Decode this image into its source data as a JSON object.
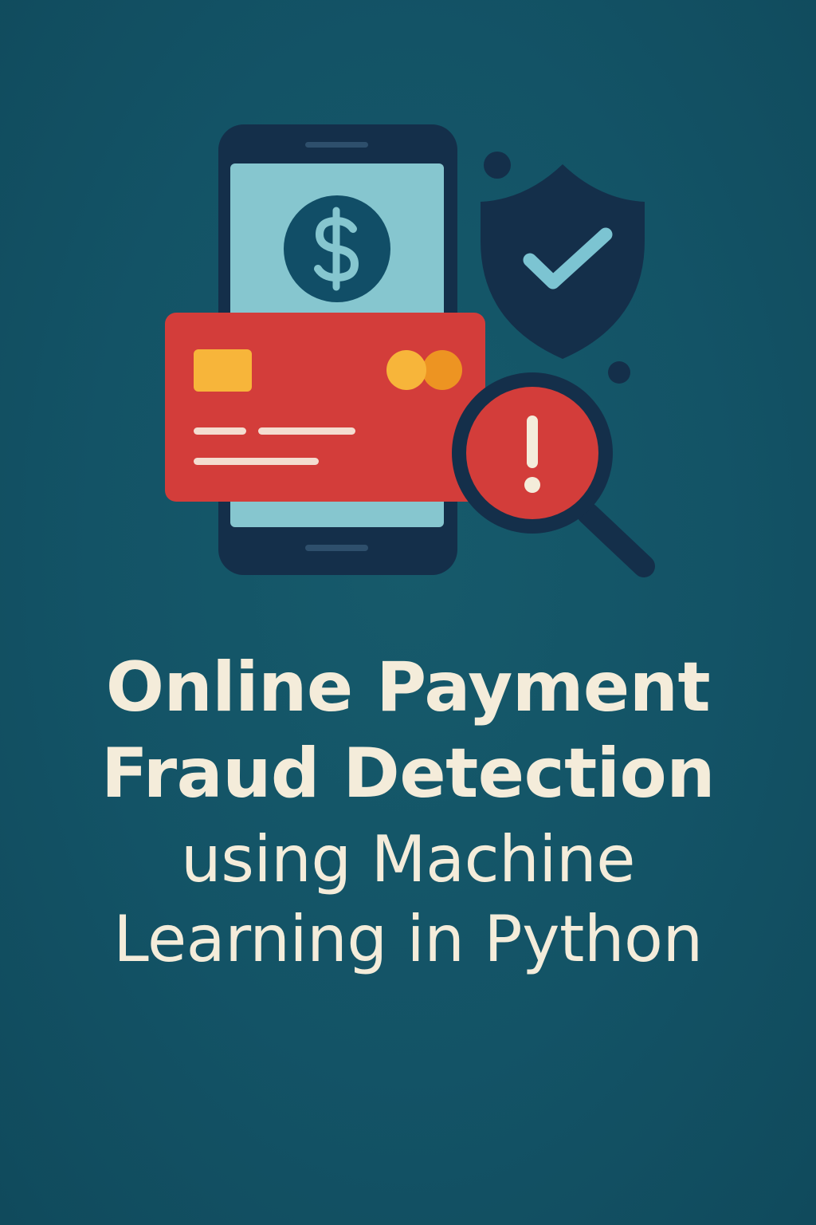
{
  "title": {
    "line1": "Online Payment",
    "line2": "Fraud Detection"
  },
  "subtitle": {
    "line1": "using Machine",
    "line2": "Learning in Python"
  },
  "icons": [
    "smartphone-icon",
    "dollar-coin-icon",
    "credit-card-icon",
    "shield-check-icon",
    "magnifier-alert-icon"
  ],
  "colors": {
    "background": "#135366",
    "navy": "#142f4a",
    "screen": "#86c6cf",
    "card_red": "#d33d3a",
    "chip_yellow": "#f7b53a",
    "logo_orange": "#ed9422",
    "text_cream": "#f4ecda",
    "check_blue": "#7cc4d2"
  }
}
